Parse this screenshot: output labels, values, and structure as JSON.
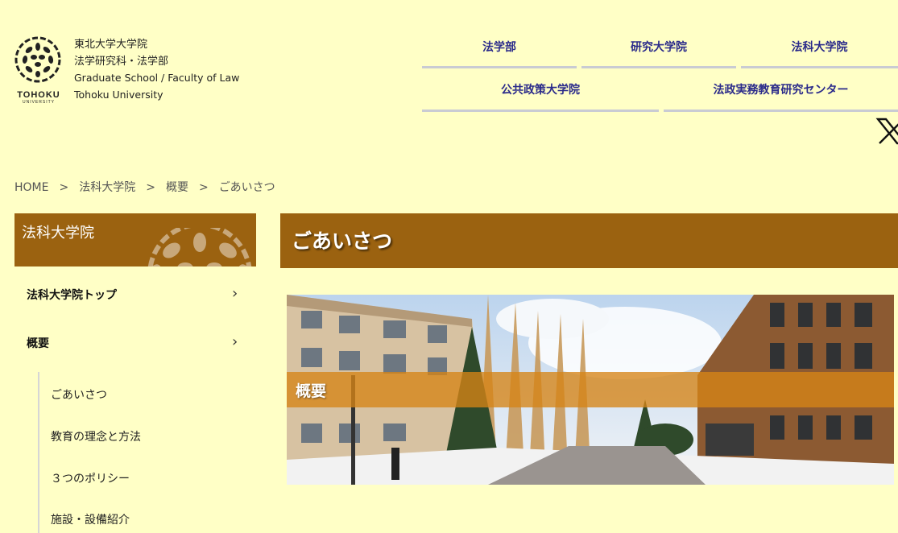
{
  "header": {
    "logo_text": "TOHOKU",
    "logo_sub": "UNIVERSITY",
    "title_lines": [
      "東北大学大学院",
      "法学研究科・法学部",
      "Graduate School / Faculty of Law",
      "Tohoku University"
    ]
  },
  "topnav": {
    "law_faculty": "法学部",
    "graduate_school": "研究大学院",
    "law_school": "法科大学院",
    "public_policy": "公共政策大学院",
    "research_center": "法政実務教育研究センター"
  },
  "breadcrumb": {
    "home": "HOME",
    "sep": ">",
    "law_school": "法科大学院",
    "overview": "概要",
    "current": "ごあいさつ"
  },
  "sidebar": {
    "heading": "法科大学院",
    "items": [
      {
        "label": "法科大学院トップ",
        "chevron": "›"
      },
      {
        "label": "概要",
        "chevron": "›"
      }
    ],
    "subitems": [
      "ごあいさつ",
      "教育の理念と方法",
      "３つのポリシー",
      "施設・設備紹介"
    ]
  },
  "main": {
    "title": "ごあいさつ",
    "hero_label": "概要"
  },
  "colors": {
    "background": "#ffffc6",
    "accent_brown": "#9b6210",
    "nav_text": "#2a2a8a",
    "band_orange": "#d68416"
  },
  "icons": {
    "logo": "tohoku-leaf-emblem",
    "social": "x-icon",
    "chevron": "chevron-right-icon"
  }
}
